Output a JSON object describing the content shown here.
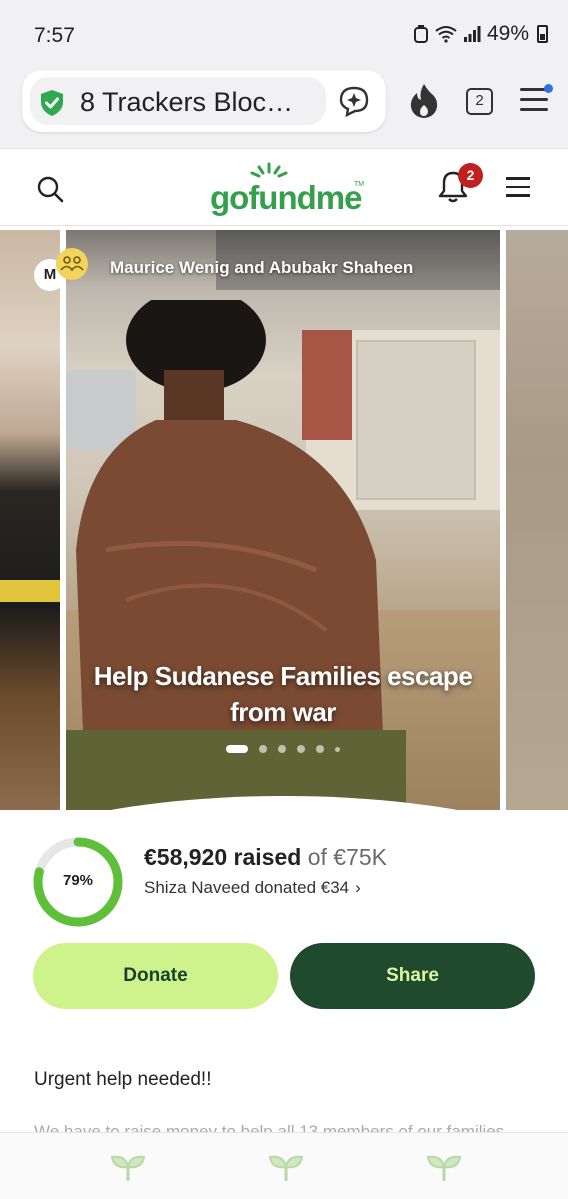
{
  "status_bar": {
    "time": "7:57",
    "battery": "49%"
  },
  "browser": {
    "tracker_text": "8 Trackers Bloc…",
    "tab_count": "2"
  },
  "site": {
    "logo": "gofundme",
    "logo_tm": "TM",
    "notification_count": "2"
  },
  "campaign": {
    "organizer_initial": "M",
    "organizers": "Maurice Wenig and Abubakr Shaheen",
    "title_line1": "Help Sudanese Families escape",
    "title_line2": "from war",
    "slides": 6,
    "active_slide": 0
  },
  "progress": {
    "percent_label": "79%",
    "percent": 0.79,
    "raised": "€58,920 raised",
    "goal": "of €75K",
    "recent_donation": "Shiza Naveed donated €34",
    "chevron": "›"
  },
  "actions": {
    "donate_label": "Donate",
    "share_label": "Share"
  },
  "story": {
    "heading": "Urgent help needed!!",
    "preview": "We have to raise money to help all 13 members of our families"
  },
  "colors": {
    "brand_green": "#35a04c",
    "donate_bg": "#cef38d",
    "share_bg": "#1f4a2e",
    "badge_red": "#c21f1f",
    "progress_green": "#5fbf3a"
  },
  "icons": [
    "shield-check-icon",
    "ai-sparkle-icon",
    "fire-icon",
    "tabs-icon",
    "menu-icon",
    "search-icon",
    "bell-icon",
    "hamburger-icon",
    "team-icon",
    "sprout-icon"
  ]
}
